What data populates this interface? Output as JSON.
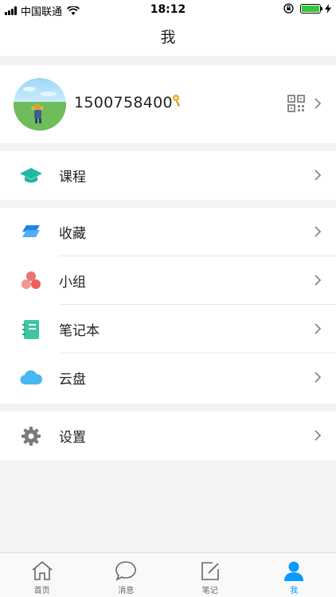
{
  "status_bar": {
    "carrier": "中国联通",
    "time": "18:12"
  },
  "nav": {
    "title": "我"
  },
  "profile": {
    "phone": "1500758400",
    "avatar_icon": "avatar-photo",
    "badge_icon": "key-badge-icon",
    "qr_icon": "qr-code-icon"
  },
  "menu_groups": [
    [
      {
        "label": "课程",
        "icon": "graduation-cap-icon",
        "color": "#1fb8a3"
      }
    ],
    [
      {
        "label": "收藏",
        "icon": "layers-icon",
        "color": "#1b86e5"
      },
      {
        "label": "小组",
        "icon": "group-circles-icon",
        "color": "#f07272"
      },
      {
        "label": "笔记本",
        "icon": "notebook-icon",
        "color": "#3cc7a2"
      },
      {
        "label": "云盘",
        "icon": "cloud-icon",
        "color": "#49b6f5"
      }
    ],
    [
      {
        "label": "设置",
        "icon": "gear-icon",
        "color": "#7a7a7a"
      }
    ]
  ],
  "tabs": [
    {
      "label": "首页",
      "icon": "home-icon",
      "active": false
    },
    {
      "label": "消息",
      "icon": "chat-bubble-icon",
      "active": false
    },
    {
      "label": "笔记",
      "icon": "edit-note-icon",
      "active": false
    },
    {
      "label": "我",
      "icon": "person-icon",
      "active": true
    }
  ],
  "colors": {
    "accent": "#0b99ff",
    "background": "#f2f3f5"
  }
}
